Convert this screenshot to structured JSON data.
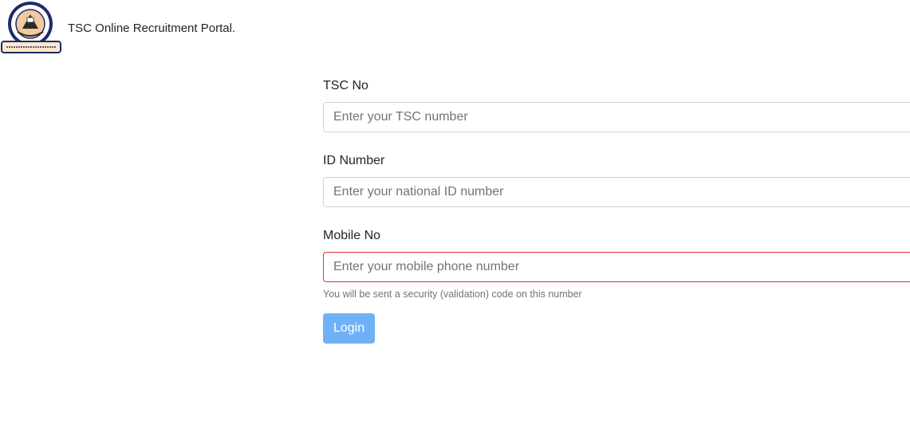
{
  "header": {
    "title": "TSC Online Recruitment Portal.",
    "logo_name": "tsc-seal-logo"
  },
  "form": {
    "tsc_no": {
      "label": "TSC No",
      "placeholder": "Enter your TSC number",
      "value": ""
    },
    "id_number": {
      "label": "ID Number",
      "placeholder": "Enter your national ID number",
      "value": ""
    },
    "mobile_no": {
      "label": "Mobile No",
      "placeholder": "Enter your mobile phone number",
      "value": "",
      "help": "You will be sent a security (validation) code on this number"
    },
    "login_label": "Login"
  },
  "colors": {
    "invalid_border": "#dc3545",
    "button_bg": "#6fb1f7",
    "input_border": "#ced4da"
  }
}
